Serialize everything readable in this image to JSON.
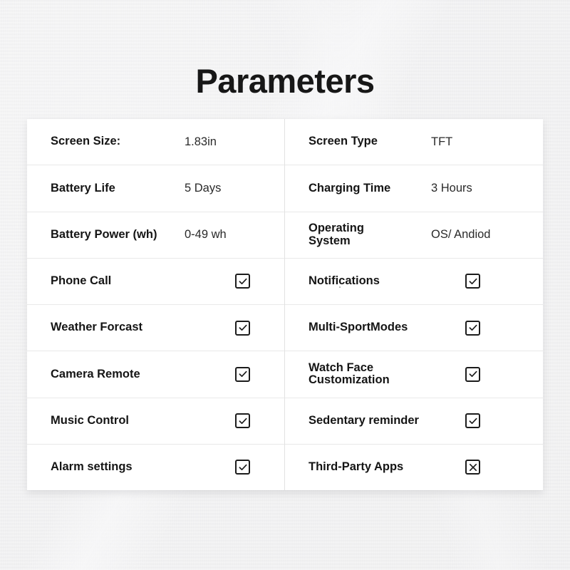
{
  "page": {
    "title": "Parameters",
    "background_color": "#f1f1f2",
    "card_color": "#ffffff",
    "text_color": "#151515",
    "value_color": "#2a2a2a"
  },
  "table": {
    "left_column": [
      {
        "label": "Screen Size:",
        "type": "value",
        "value": "1.83in"
      },
      {
        "label": "Battery Life",
        "type": "value",
        "value": "5 Days"
      },
      {
        "label": "Battery Power (wh)",
        "type": "value",
        "value": "0-49 wh"
      },
      {
        "label": "Phone Call",
        "type": "checkbox",
        "checked": true,
        "mark": "check"
      },
      {
        "label": "Weather Forcast",
        "type": "checkbox",
        "checked": true,
        "mark": "check"
      },
      {
        "label": "Camera Remote",
        "type": "checkbox",
        "checked": true,
        "mark": "check"
      },
      {
        "label": "Music Control",
        "type": "checkbox",
        "checked": true,
        "mark": "check"
      },
      {
        "label": "Alarm settings",
        "type": "checkbox",
        "checked": true,
        "mark": "check"
      }
    ],
    "right_column": [
      {
        "label": "Screen Type",
        "type": "value",
        "value": "TFT"
      },
      {
        "label": "Charging Time",
        "type": "value",
        "value": "3 Hours"
      },
      {
        "label": "Operating\nSystem",
        "type": "value",
        "value": "OS/ Andiod"
      },
      {
        "label": "Notifications",
        "type": "checkbox",
        "checked": true,
        "mark": "check"
      },
      {
        "label": "Multi-SportModes",
        "type": "checkbox",
        "checked": true,
        "mark": "check"
      },
      {
        "label": "Watch Face\nCustomization",
        "type": "checkbox",
        "checked": true,
        "mark": "check"
      },
      {
        "label": "Sedentary reminder",
        "type": "checkbox",
        "checked": true,
        "mark": "check"
      },
      {
        "label": "Third-Party Apps",
        "type": "checkbox",
        "checked": false,
        "mark": "cross"
      }
    ]
  }
}
